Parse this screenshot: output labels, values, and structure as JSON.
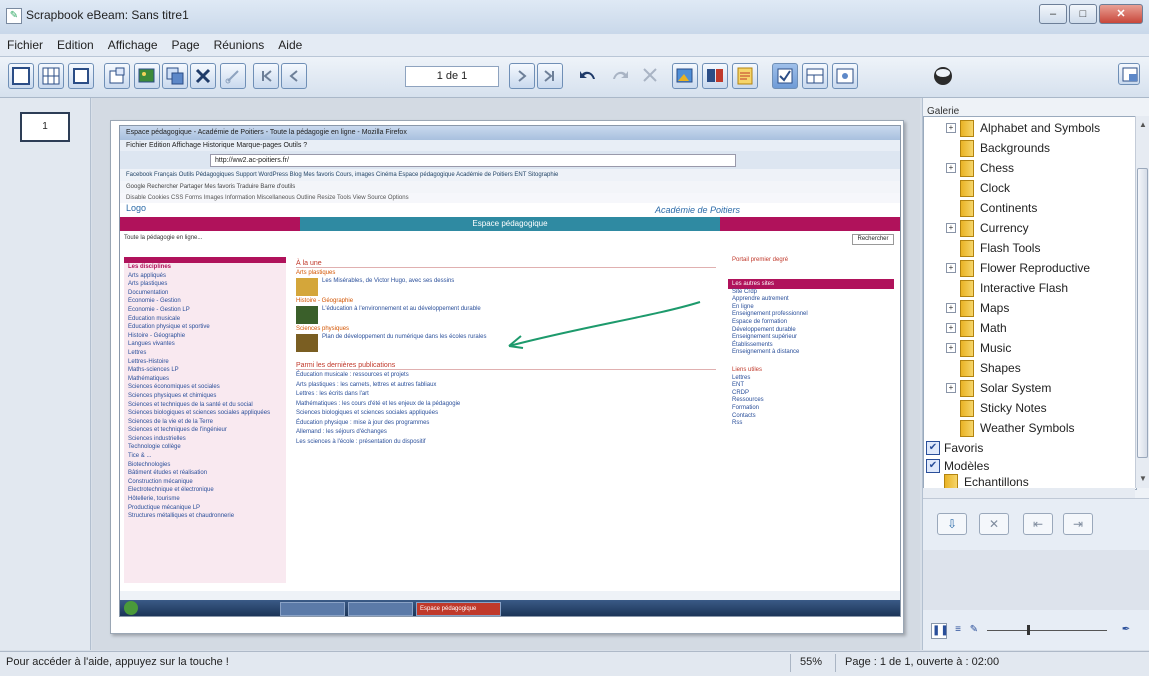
{
  "window": {
    "title": "Scrapbook eBeam: Sans titre1"
  },
  "menu": [
    "Fichier",
    "Edition",
    "Affichage",
    "Page",
    "Réunions",
    "Aide"
  ],
  "toolbar": {
    "page_counter": "1 de 1"
  },
  "pages_panel": {
    "thumbnail_label": "1"
  },
  "browser_shot": {
    "title": "Espace pédagogique - Académie de Poitiers - Toute la pédagogie en ligne - Mozilla Firefox",
    "menu": "Fichier  Edition  Affichage  Historique  Marque-pages  Outils  ?",
    "url": "http://ww2.ac-poitiers.fr/",
    "bookmarks": "Facebook  Français  Outils Pédagogiques  Support WordPress  Blog  Mes favoris  Cours, images  Cinéma  Espace pédagogique  Académie de Poitiers  ENT  Sitographie",
    "google_bar": "Google  Rechercher  Partager  Mes favoris  Traduire  Barre d'outils",
    "tools_bar": "Disable  Cookies  CSS  Forms  Images  Information  Miscellaneous  Outline  Resize  Tools  View Source  Options",
    "site_logo": "Logo",
    "academie": "Académie de Poitiers",
    "band_title": "Espace pédagogique",
    "search_text": "Toute la pédagogie en ligne...",
    "search_btn": "Rechercher",
    "left_links": [
      "Les disciplines",
      "Arts appliqués",
      "Arts plastiques",
      "Documentation",
      "Économie - Gestion",
      "Économie - Gestion LP",
      "Éducation musicale",
      "Éducation physique et sportive",
      "Histoire - Géographie",
      "Langues vivantes",
      "Lettres",
      "Lettres-Histoire",
      "Maths-sciences LP",
      "Mathématiques",
      "Sciences économiques et sociales",
      "Sciences physiques et chimiques",
      "Sciences et techniques de la santé et du social",
      "Sciences biologiques et sciences sociales appliquées",
      "Sciences de la vie et de la Terre",
      "Sciences et techniques de l'ingénieur",
      "Sciences industrielles",
      "Technologie collège",
      "Tice & ...",
      "Biotechnologies",
      "Bâtiment études et réalisation",
      "Construction mécanique",
      "Electrotechnique et électronique",
      "Hôtellerie, tourisme",
      "Productique mécanique LP",
      "Structures métalliques et chaudronnerie"
    ],
    "mid": {
      "h1": "À la une",
      "s1": "Arts plastiques",
      "t1": "Les Misérables, de Victor Hugo, avec ses dessins",
      "s2": "Histoire - Géographie",
      "t2": "L'éducation à l'environnement et au développement durable",
      "s3": "Sciences physiques",
      "t3": "Plan de développement du numérique dans les écoles rurales",
      "h2": "Parmi les dernières publications",
      "list": [
        "Éducation musicale : ressources et projets",
        "Arts plastiques : les carnets, lettres et autres fabliaux",
        "Lettres : les écrits dans l'art",
        "Mathématiques : les cours d'été et les enjeux de la pédagogie",
        "Sciences biologiques et sciences sociales appliquées",
        "Éducation physique : mise à jour des programmes",
        "Allemand : les séjours d'échanges",
        "Les sciences à l'école : présentation du dispositif"
      ]
    },
    "right": {
      "h1": "Portail premier degré",
      "h2": "Les autres sites",
      "links": [
        "Site Crdp",
        "Apprendre autrement",
        "En ligne",
        "Enseignement professionnel",
        "Espace de formation",
        "Développement durable",
        "Enseignement supérieur",
        "Établissements",
        "Enseignement à distance"
      ],
      "h3": "Liens utiles",
      "links2": [
        "Lettres",
        "ENT",
        "CRDP",
        "Ressources",
        "Formation",
        "Contacts",
        "Rss"
      ]
    },
    "task_active": "Espace pédagogique"
  },
  "gallery": {
    "label": "Galerie",
    "items": [
      {
        "name": "Alphabet and Symbols",
        "expander": "+"
      },
      {
        "name": "Backgrounds",
        "expander": ""
      },
      {
        "name": "Chess",
        "expander": "+"
      },
      {
        "name": "Clock",
        "expander": ""
      },
      {
        "name": "Continents",
        "expander": ""
      },
      {
        "name": "Currency",
        "expander": "+"
      },
      {
        "name": "Flash Tools",
        "expander": ""
      },
      {
        "name": "Flower Reproductive",
        "expander": "+"
      },
      {
        "name": "Interactive Flash",
        "expander": ""
      },
      {
        "name": "Maps",
        "expander": "+"
      },
      {
        "name": "Math",
        "expander": "+"
      },
      {
        "name": "Music",
        "expander": "+"
      },
      {
        "name": "Shapes",
        "expander": ""
      },
      {
        "name": "Solar System",
        "expander": "+"
      },
      {
        "name": "Sticky Notes",
        "expander": ""
      },
      {
        "name": "Weather Symbols",
        "expander": ""
      }
    ],
    "roots": [
      {
        "name": "Favoris"
      },
      {
        "name": "Modèles"
      },
      {
        "name": "Echantillons"
      }
    ]
  },
  "status": {
    "help": "Pour accéder à l'aide, appuyez sur la touche !",
    "zoom": "55%",
    "page": "Page : 1 de 1, ouverte à : 02:00"
  }
}
